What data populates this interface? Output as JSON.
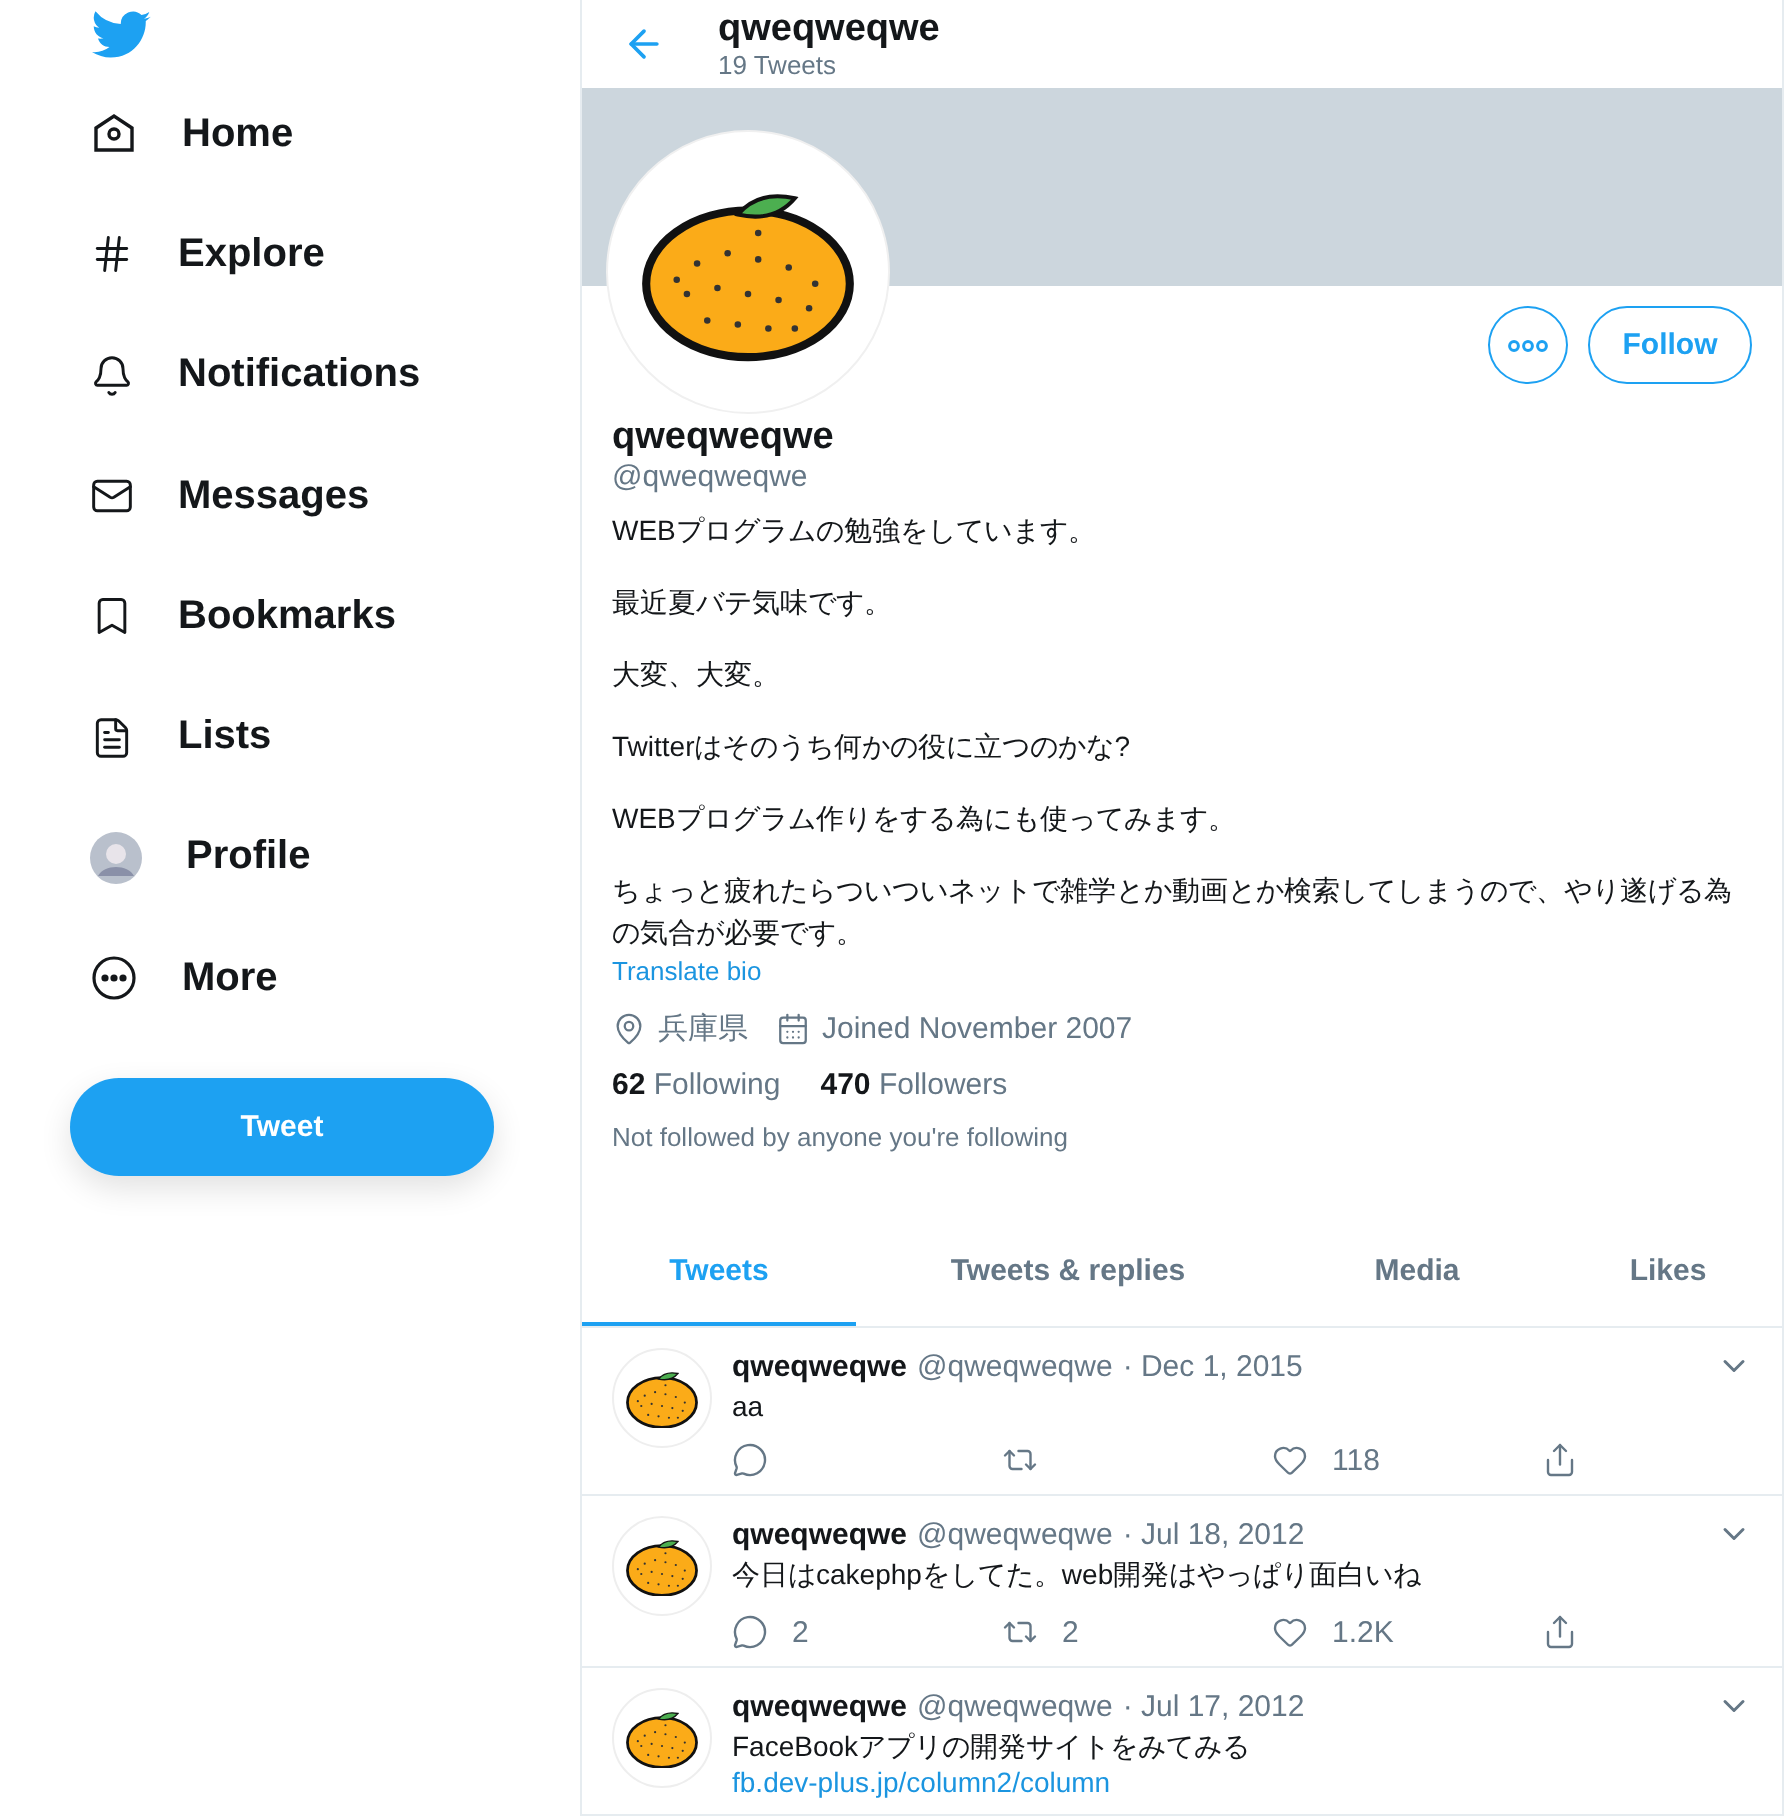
{
  "sidebar": {
    "items": [
      {
        "kind": "home",
        "label": "Home"
      },
      {
        "kind": "explore",
        "label": "Explore"
      },
      {
        "kind": "notifications",
        "label": "Notifications"
      },
      {
        "kind": "messages",
        "label": "Messages"
      },
      {
        "kind": "bookmarks",
        "label": "Bookmarks"
      },
      {
        "kind": "lists",
        "label": "Lists"
      },
      {
        "kind": "profile",
        "label": "Profile"
      },
      {
        "kind": "more",
        "label": "More"
      }
    ],
    "tweet_button": "Tweet"
  },
  "header": {
    "title": "qweqweqwe",
    "subtitle": "19 Tweets"
  },
  "profile": {
    "name": "qweqweqwe",
    "handle": "@qweqweqwe",
    "follow_button": "Follow",
    "bio": [
      "WEBプログラムの勉強をしています。",
      "最近夏バテ気味です。",
      "大変、大変。",
      "Twitterはそのうち何かの役に立つのかな?",
      "WEBプログラム作りをする為にも使ってみます。",
      "ちょっと疲れたらついついネットで雑学とか動画とか検索してしまうので、やり遂げる為の気合が必要です。"
    ],
    "translate": "Translate bio",
    "location": "兵庫県",
    "joined": "Joined November 2007",
    "following_count": "62",
    "following_label": "Following",
    "followers_count": "470",
    "followers_label": "Followers",
    "note": "Not followed by anyone you're following"
  },
  "tabs": [
    {
      "label": "Tweets",
      "selected": true
    },
    {
      "label": "Tweets & replies",
      "selected": false
    },
    {
      "label": "Media",
      "selected": false
    },
    {
      "label": "Likes",
      "selected": false
    }
  ],
  "tweets": [
    {
      "name": "qweqweqwe",
      "handle": "@qweqweqwe",
      "date": "· Dec 1, 2015",
      "text": "aa",
      "likes": "118"
    },
    {
      "name": "qweqweqwe",
      "handle": "@qweqweqwe",
      "date": "· Jul 18, 2012",
      "text": "今日はcakephpをしてた。web開発はやっぱり面白いね",
      "replies": "2",
      "retweets": "2",
      "likes": "1.2K"
    },
    {
      "name": "qweqweqwe",
      "handle": "@qweqweqwe",
      "date": "· Jul 17, 2012",
      "text": "FaceBookアプリの開発サイトをみてみる",
      "link": "fb.dev-plus.jp/column2/column"
    }
  ]
}
